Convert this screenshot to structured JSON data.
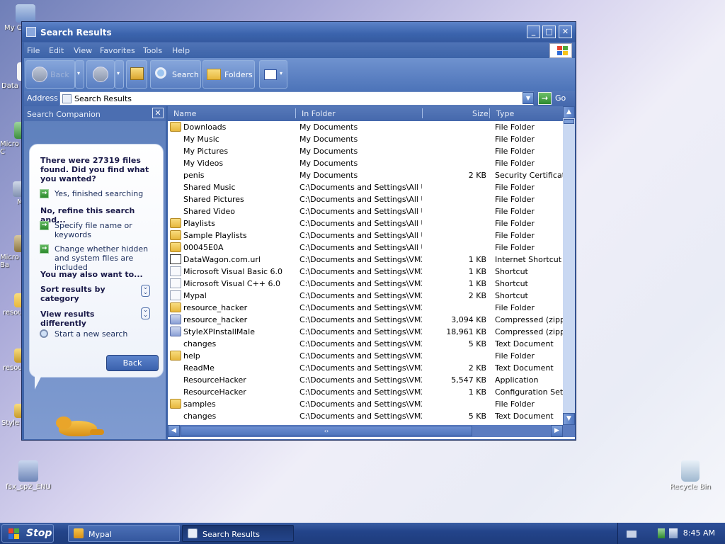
{
  "desktop": {
    "icons": [
      {
        "label": "My C",
        "id": "my-computer"
      },
      {
        "label": "Data",
        "id": "datawagon"
      },
      {
        "label": "Micro\nC",
        "id": "microsoft-c"
      },
      {
        "label": "M",
        "id": "m"
      },
      {
        "label": "Micro\nBa",
        "id": "microsoft-basic"
      },
      {
        "label": "resou",
        "id": "resource"
      },
      {
        "label": "resou",
        "id": "resource2"
      },
      {
        "label": "Style",
        "id": "style"
      },
      {
        "label": "fsx_sp2_ENU",
        "id": "fsx-sp2"
      },
      {
        "label": "Recycle Bin",
        "id": "recycle-bin"
      }
    ]
  },
  "window": {
    "title": "Search Results",
    "menu": [
      "File",
      "Edit",
      "View",
      "Favorites",
      "Tools",
      "Help"
    ],
    "toolbar": {
      "back": "Back",
      "search": "Search",
      "folders": "Folders"
    },
    "address": {
      "label": "Address",
      "value": "Search Results",
      "go": "Go"
    }
  },
  "companion": {
    "header": "Search Companion",
    "found_text": "There were 27319 files found. Did you find what you wanted?",
    "yes_option": "Yes, finished searching",
    "refine_heading": "No, refine this search and...",
    "refine_options": [
      "Specify file name or keywords",
      "Change whether hidden and system files are included"
    ],
    "also_heading": "You may also want to...",
    "sort_label": "Sort results by category",
    "view_label": "View results differently",
    "new_search": "Start a new search",
    "back_button": "Back"
  },
  "columns": {
    "name": "Name",
    "folder": "In Folder",
    "size": "Size",
    "type": "Type"
  },
  "rows": [
    {
      "name": "Downloads",
      "folder": "My Documents",
      "size": "",
      "type": "File Folder",
      "icon": "folder"
    },
    {
      "name": "My Music",
      "folder": "My Documents",
      "size": "",
      "type": "File Folder",
      "icon": "none"
    },
    {
      "name": "My Pictures",
      "folder": "My Documents",
      "size": "",
      "type": "File Folder",
      "icon": "none"
    },
    {
      "name": "My Videos",
      "folder": "My Documents",
      "size": "",
      "type": "File Folder",
      "icon": "none"
    },
    {
      "name": "penis",
      "folder": "My Documents",
      "size": "2 KB",
      "type": "Security Certificate",
      "icon": "none"
    },
    {
      "name": "Shared Music",
      "folder": "C:\\Documents and Settings\\All U...",
      "size": "",
      "type": "File Folder",
      "icon": "none"
    },
    {
      "name": "Shared Pictures",
      "folder": "C:\\Documents and Settings\\All U...",
      "size": "",
      "type": "File Folder",
      "icon": "none"
    },
    {
      "name": "Shared Video",
      "folder": "C:\\Documents and Settings\\All U...",
      "size": "",
      "type": "File Folder",
      "icon": "none"
    },
    {
      "name": "Playlists",
      "folder": "C:\\Documents and Settings\\All U...",
      "size": "",
      "type": "File Folder",
      "icon": "folder"
    },
    {
      "name": "Sample Playlists",
      "folder": "C:\\Documents and Settings\\All U...",
      "size": "",
      "type": "File Folder",
      "icon": "folder"
    },
    {
      "name": "00045E0A",
      "folder": "C:\\Documents and Settings\\All U...",
      "size": "",
      "type": "File Folder",
      "icon": "folder"
    },
    {
      "name": "DataWagon.com.url",
      "folder": "C:\\Documents and Settings\\VM2...",
      "size": "1 KB",
      "type": "Internet Shortcut",
      "icon": "url"
    },
    {
      "name": "Microsoft Visual Basic 6.0",
      "folder": "C:\\Documents and Settings\\VM2...",
      "size": "1 KB",
      "type": "Shortcut",
      "icon": "doc"
    },
    {
      "name": "Microsoft Visual C++ 6.0",
      "folder": "C:\\Documents and Settings\\VM2...",
      "size": "1 KB",
      "type": "Shortcut",
      "icon": "doc"
    },
    {
      "name": "Mypal",
      "folder": "C:\\Documents and Settings\\VM2...",
      "size": "2 KB",
      "type": "Shortcut",
      "icon": "doc"
    },
    {
      "name": "resource_hacker",
      "folder": "C:\\Documents and Settings\\VM2...",
      "size": "",
      "type": "File Folder",
      "icon": "folder"
    },
    {
      "name": "resource_hacker",
      "folder": "C:\\Documents and Settings\\VM2...",
      "size": "3,094 KB",
      "type": "Compressed (zippe...",
      "icon": "zip"
    },
    {
      "name": "StyleXPInstallMale",
      "folder": "C:\\Documents and Settings\\VM2...",
      "size": "18,961 KB",
      "type": "Compressed (zippe...",
      "icon": "zip"
    },
    {
      "name": "changes",
      "folder": "C:\\Documents and Settings\\VM2...",
      "size": "5 KB",
      "type": "Text Document",
      "icon": "none"
    },
    {
      "name": "help",
      "folder": "C:\\Documents and Settings\\VM2...",
      "size": "",
      "type": "File Folder",
      "icon": "folder"
    },
    {
      "name": "ReadMe",
      "folder": "C:\\Documents and Settings\\VM2...",
      "size": "2 KB",
      "type": "Text Document",
      "icon": "none"
    },
    {
      "name": "ResourceHacker",
      "folder": "C:\\Documents and Settings\\VM2...",
      "size": "5,547 KB",
      "type": "Application",
      "icon": "none"
    },
    {
      "name": "ResourceHacker",
      "folder": "C:\\Documents and Settings\\VM2...",
      "size": "1 KB",
      "type": "Configuration Settin...",
      "icon": "none"
    },
    {
      "name": "samples",
      "folder": "C:\\Documents and Settings\\VM2...",
      "size": "",
      "type": "File Folder",
      "icon": "folder"
    },
    {
      "name": "changes",
      "folder": "C:\\Documents and Settings\\VM2...",
      "size": "5 KB",
      "type": "Text Document",
      "icon": "none"
    }
  ],
  "taskbar": {
    "start": "Stop",
    "tasks": [
      {
        "label": "Mypal",
        "active": false
      },
      {
        "label": "Search Results",
        "active": true
      }
    ],
    "clock": "8:45 AM"
  },
  "colors": {
    "accent": "#3b64ad",
    "folder": "#e7b73d"
  }
}
